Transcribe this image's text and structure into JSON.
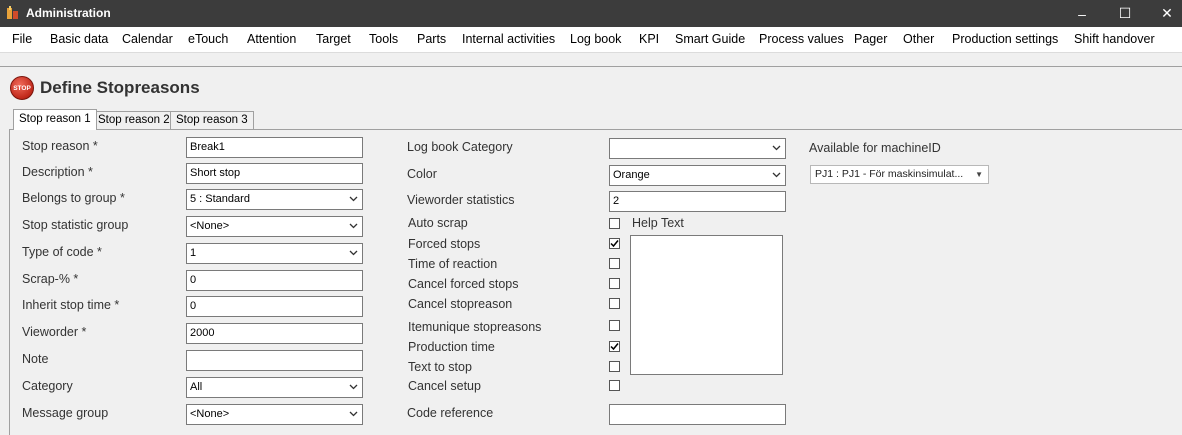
{
  "window": {
    "title": "Administration",
    "controls": {
      "minimize": "–",
      "maximize": "☐",
      "close": "✕"
    }
  },
  "menu": [
    "File",
    "Basic data",
    "Calendar",
    "eTouch",
    "Attention",
    "Target",
    "Tools",
    "Parts",
    "Internal activities",
    "Log book",
    "KPI",
    "Smart Guide",
    "Process values",
    "Pager",
    "Other",
    "Production settings",
    "Shift handover"
  ],
  "header": {
    "icon_text": "STOP",
    "title": "Define Stopreasons"
  },
  "tabs": [
    "Stop reason 1",
    "Stop reason 2",
    "Stop reason 3"
  ],
  "left_form": {
    "stop_reason": {
      "label": "Stop reason *",
      "value": "Break1"
    },
    "description": {
      "label": "Description *",
      "value": "Short stop"
    },
    "belongs_to_group": {
      "label": "Belongs to group *",
      "value": "5 : Standard"
    },
    "stop_statistic_group": {
      "label": "Stop statistic group",
      "value": "<None>"
    },
    "type_of_code": {
      "label": "Type of code *",
      "value": "1"
    },
    "scrap_pct": {
      "label": "Scrap-% *",
      "value": "0"
    },
    "inherit_stop_time": {
      "label": "Inherit stop time *",
      "value": "0"
    },
    "vieworder": {
      "label": "Vieworder *",
      "value": "2000"
    },
    "note": {
      "label": "Note",
      "value": ""
    },
    "category": {
      "label": "Category",
      "value": "All"
    },
    "message_group": {
      "label": "Message group",
      "value": "<None>"
    }
  },
  "middle_form": {
    "log_book_category": {
      "label": "Log book Category",
      "value": ""
    },
    "color": {
      "label": "Color",
      "value": "Orange"
    },
    "vieworder_statistics": {
      "label": "Vieworder statistics",
      "value": "2"
    },
    "auto_scrap": {
      "label": "Auto scrap",
      "checked": false
    },
    "help_text": {
      "label": "Help Text",
      "checked": false
    },
    "forced_stops": {
      "label": "Forced stops",
      "checked": true
    },
    "time_of_reaction": {
      "label": "Time of reaction",
      "checked": false
    },
    "cancel_forced_stops": {
      "label": "Cancel forced stops",
      "checked": false
    },
    "cancel_stopreason": {
      "label": "Cancel stopreason",
      "checked": false
    },
    "itemunique_stopreasons": {
      "label": "Itemunique stopreasons",
      "checked": false
    },
    "production_time": {
      "label": "Production time",
      "checked": true
    },
    "text_to_stop": {
      "label": "Text to stop",
      "checked": false
    },
    "cancel_setup": {
      "label": "Cancel setup",
      "checked": false
    },
    "code_reference": {
      "label": "Code reference",
      "value": ""
    }
  },
  "right_panel": {
    "available_label": "Available for machineID",
    "machine_value": "PJ1 : PJ1 - För maskinsimulat..."
  }
}
